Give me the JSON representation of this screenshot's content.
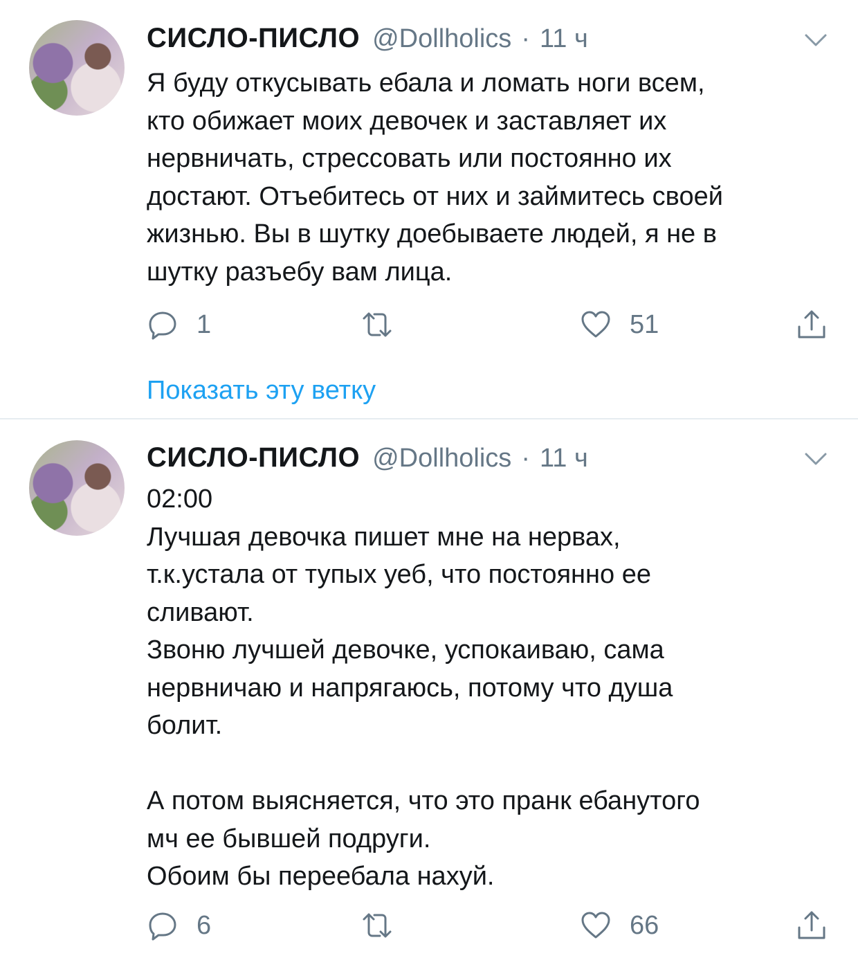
{
  "colors": {
    "accent": "#1da1f2",
    "secondary": "#657786",
    "text": "#14171a",
    "divider": "#e6ecf0"
  },
  "tweets": [
    {
      "author": {
        "name": "СИСЛО-ПИСЛО",
        "handle": "@Dollholics",
        "dot": "·",
        "time": "11 ч",
        "avatar": "avatar-photo"
      },
      "text": "Я буду откусывать ебала и ломать ноги всем,\nкто обижает моих девочек и заставляет их\nнервничать, стрессовать или постоянно их\nдостают. Отъебитесь от них и займитесь своей\nжизнью. Вы в шутку доебываете людей, я не в\nшутку разъебу вам лица.",
      "actions": {
        "replies": "1",
        "retweets": "",
        "likes": "51"
      },
      "show_thread": "Показать эту ветку"
    },
    {
      "author": {
        "name": "СИСЛО-ПИСЛО",
        "handle": "@Dollholics",
        "dot": "·",
        "time": "11 ч",
        "avatar": "avatar-photo"
      },
      "text": "02:00\nЛучшая девочка пишет мне на нервах,\nт.к.устала от тупых уеб, что постоянно ее\nсливают.\nЗвоню лучшей девочке, успокаиваю, сама\nнервничаю и напрягаюсь, потому что душа\nболит.\n\nА потом выясняется, что это пранк ебанутого\nмч ее бывшей подруги.\nОбоим бы переебала нахуй.",
      "actions": {
        "replies": "6",
        "retweets": "",
        "likes": "66"
      }
    }
  ]
}
